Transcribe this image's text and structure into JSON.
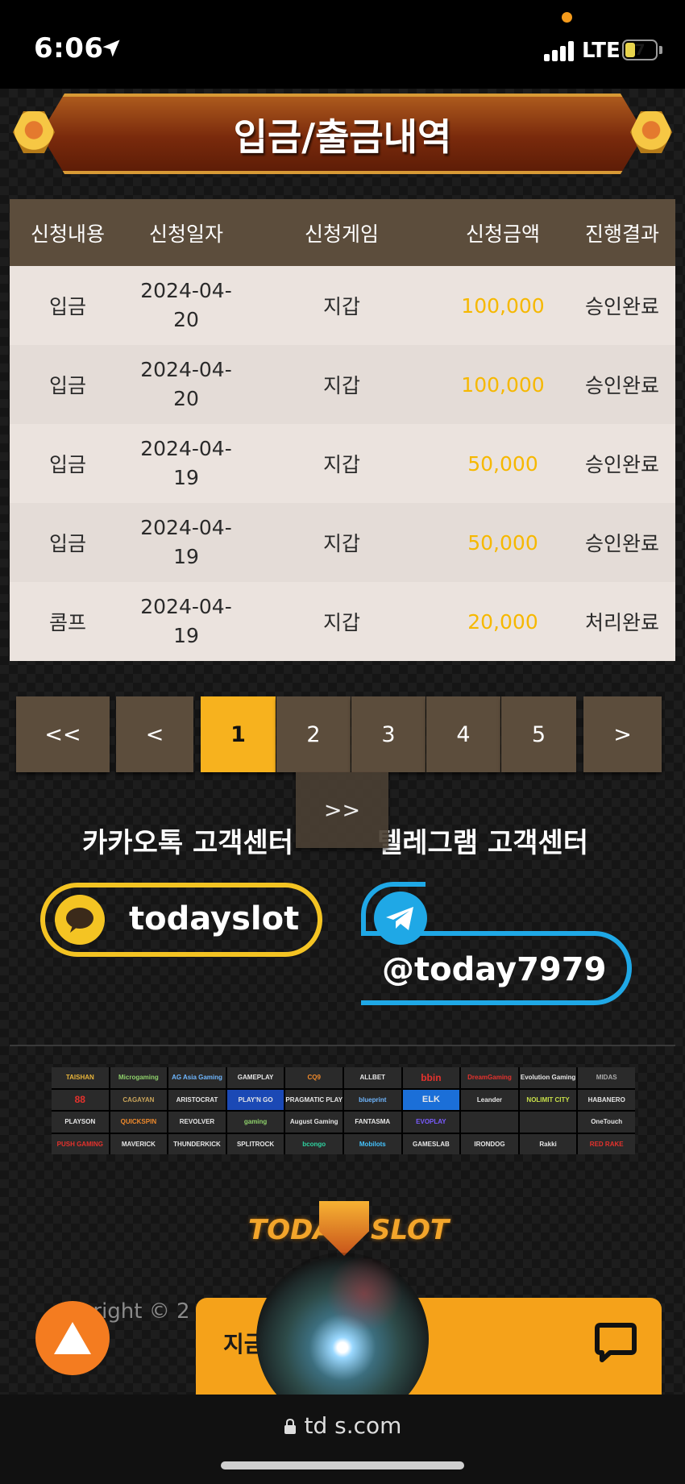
{
  "status_bar": {
    "time": "6:06",
    "network": "LTE",
    "battery": "7"
  },
  "page": {
    "title": "입금/출금내역"
  },
  "table": {
    "headers": [
      "신청내용",
      "신청일자",
      "신청게임",
      "신청금액",
      "진행결과"
    ],
    "rows": [
      {
        "type": "입금",
        "date_line1": "2024-04-",
        "date_line2": "20",
        "game": "지갑",
        "amount": "100,000",
        "result": "승인완료"
      },
      {
        "type": "입금",
        "date_line1": "2024-04-",
        "date_line2": "20",
        "game": "지갑",
        "amount": "100,000",
        "result": "승인완료"
      },
      {
        "type": "입금",
        "date_line1": "2024-04-",
        "date_line2": "19",
        "game": "지갑",
        "amount": "50,000",
        "result": "승인완료"
      },
      {
        "type": "입금",
        "date_line1": "2024-04-",
        "date_line2": "19",
        "game": "지갑",
        "amount": "50,000",
        "result": "승인완료"
      },
      {
        "type": "콤프",
        "date_line1": "2024-04-",
        "date_line2": "19",
        "game": "지갑",
        "amount": "20,000",
        "result": "처리완료"
      }
    ]
  },
  "pagination": {
    "first": "<<",
    "prev": "<",
    "pages": [
      "1",
      "2",
      "3",
      "4",
      "5"
    ],
    "current": "1",
    "next": ">",
    "last": ">>"
  },
  "support": {
    "kakao_label": "카카오톡 고객센터",
    "kakao_id": "todayslot",
    "telegram_label": "텔레그램 고객센터",
    "telegram_id": "@today7979"
  },
  "providers": [
    "TAISHAN",
    "Microgaming",
    "AG Asia Gaming",
    "GAMEPLAY",
    "CQ9",
    "ALLBET",
    "bbin",
    "DreamGaming",
    "Evolution Gaming",
    "MIDAS",
    "88",
    "CAGAYAN",
    "ARISTOCRAT",
    "PLAY'N GO",
    "PRAGMATIC PLAY",
    "blueprint",
    "ELK",
    "Leander",
    "NOLIMIT CITY",
    "HABANERO",
    "PLAYSON",
    "QUICKSPIN",
    "REVOLVER",
    "gaming",
    "August Gaming",
    "FANTASMA",
    "EVOPLAY",
    "",
    "",
    "OneTouch",
    "PUSH GAMING",
    "MAVERICK",
    "THUNDERKICK",
    "SPLITROCK",
    "bcongo",
    "Mobilots",
    "GAMESLAB",
    "IRONDOG",
    "Rakki",
    "RED RAKE"
  ],
  "brand": {
    "left": "TODAY",
    "right": "SLOT"
  },
  "footer": {
    "copyright": "yright © 2",
    "chat_label": "지금"
  },
  "browser": {
    "url": "td     s.com"
  },
  "colors": {
    "accent": "#f7b21e",
    "header_brown": "#5c4d3c",
    "amount_gold": "#f6b800",
    "kakao_yellow": "#f4c423",
    "telegram_blue": "#1fa8e6"
  }
}
